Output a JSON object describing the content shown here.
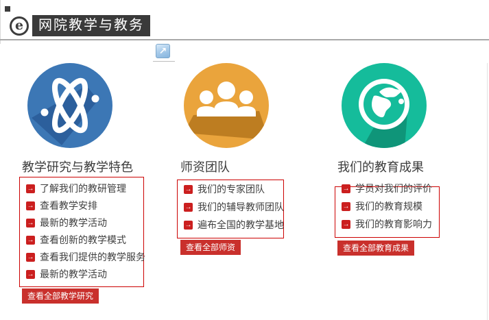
{
  "header": {
    "title": "网院教学与教务",
    "browser_icon_letter": "e",
    "popout_icon_glyph": "↗"
  },
  "columns": [
    {
      "title": "教学研究与教学特色",
      "icon": "atom-icon",
      "icon_color": "#3c77b5",
      "icon_shadow_color": "#2c5f9c",
      "links": [
        "了解我们的教研管理",
        "查看教学安排",
        "最新的教学活动",
        "查看创新的教学模式",
        "查看我们提供的教学服务",
        "最新的教学活动"
      ],
      "button": "查看全部教学研究"
    },
    {
      "title": "师资团队",
      "icon": "people-icon",
      "icon_color": "#eaa43c",
      "icon_shadow_color": "#bd7d21",
      "links": [
        "我们的专家团队",
        "我们的辅导教师团队",
        "遍布全国的教学基地"
      ],
      "button": "查看全部师资"
    },
    {
      "title": "我们的教育成果",
      "icon": "globe-icon",
      "icon_color": "#15bc9b",
      "icon_shadow_color": "#0f9579",
      "links": [
        "学员对我们的评价",
        "我们的教育规模",
        "我们的教育影响力"
      ],
      "button": "查看全部教育成果"
    }
  ],
  "colors": {
    "accent_red": "#cc0000",
    "button_red": "#c9302c",
    "arrow_red": "#cb1f1f",
    "header_bar": "#3a3a3a",
    "rule_gray": "#a8a8a8",
    "link_text": "#3e3e3e"
  },
  "arrow_glyph": "→"
}
